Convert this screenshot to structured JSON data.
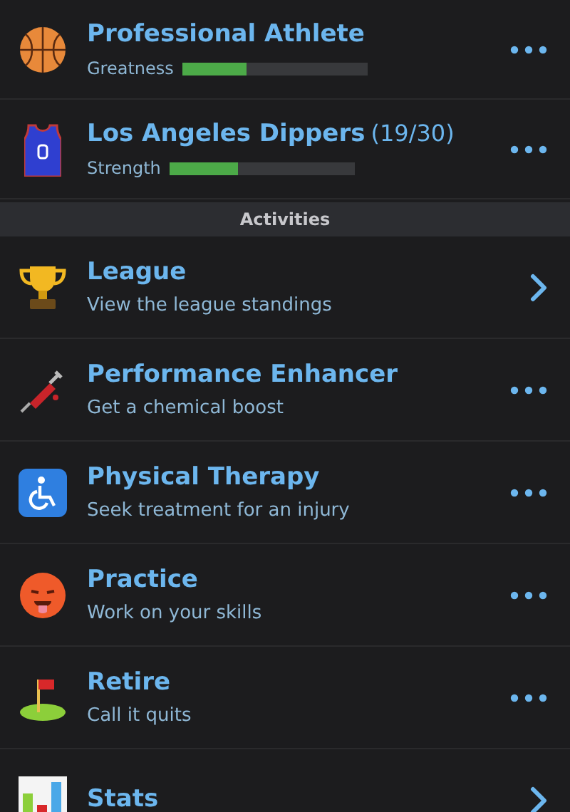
{
  "profile": [
    {
      "title": "Professional Athlete",
      "meter": {
        "label": "Greatness",
        "level": 0.35
      },
      "kind": "more"
    },
    {
      "title": "Los Angeles Dippers",
      "note": "(19/30)",
      "meter": {
        "label": "Strength",
        "level": 0.37
      },
      "kind": "more"
    }
  ],
  "section_header": "Activities",
  "activities": [
    {
      "title": "League",
      "subtitle": "View the league standings",
      "kind": "chevron"
    },
    {
      "title": "Performance Enhancer",
      "subtitle": "Get a chemical boost",
      "kind": "more"
    },
    {
      "title": "Physical Therapy",
      "subtitle": "Seek treatment for an injury",
      "kind": "more"
    },
    {
      "title": "Practice",
      "subtitle": "Work on your skills",
      "kind": "more"
    },
    {
      "title": "Retire",
      "subtitle": "Call it quits",
      "kind": "more"
    },
    {
      "title": "Stats",
      "kind": "chevron"
    }
  ]
}
